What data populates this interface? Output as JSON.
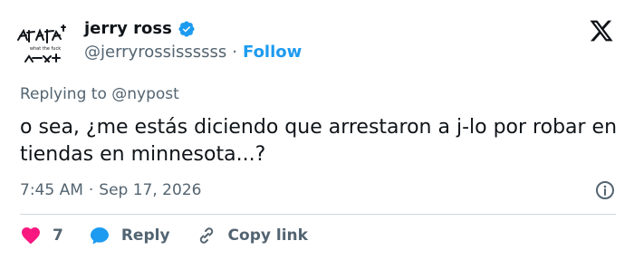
{
  "user": {
    "display_name": "jerry ross",
    "handle": "@jerryrossissssss",
    "separator": "·",
    "follow_label": "Follow",
    "avatar_caption": "what the fuck"
  },
  "tweet": {
    "replying_to": "Replying to @nypost",
    "text": "o sea, ¿me estás diciendo que arrestaron a j-lo por robar en tiendas en minnesota...?",
    "time": "7:45 AM",
    "separator": "·",
    "date": "Sep 17, 2026"
  },
  "actions": {
    "like_count": "7",
    "reply_label": "Reply",
    "copy_link_label": "Copy link"
  },
  "icons": {
    "verified": "verified-badge-icon",
    "x_logo": "x-logo-icon",
    "info": "info-icon",
    "heart": "heart-icon",
    "reply": "reply-bubble-icon",
    "link": "link-icon"
  },
  "colors": {
    "accent": "#1d9bf0",
    "heart": "#f91880",
    "text": "#0f1419",
    "secondary": "#536471",
    "divider": "#cfd9de"
  }
}
